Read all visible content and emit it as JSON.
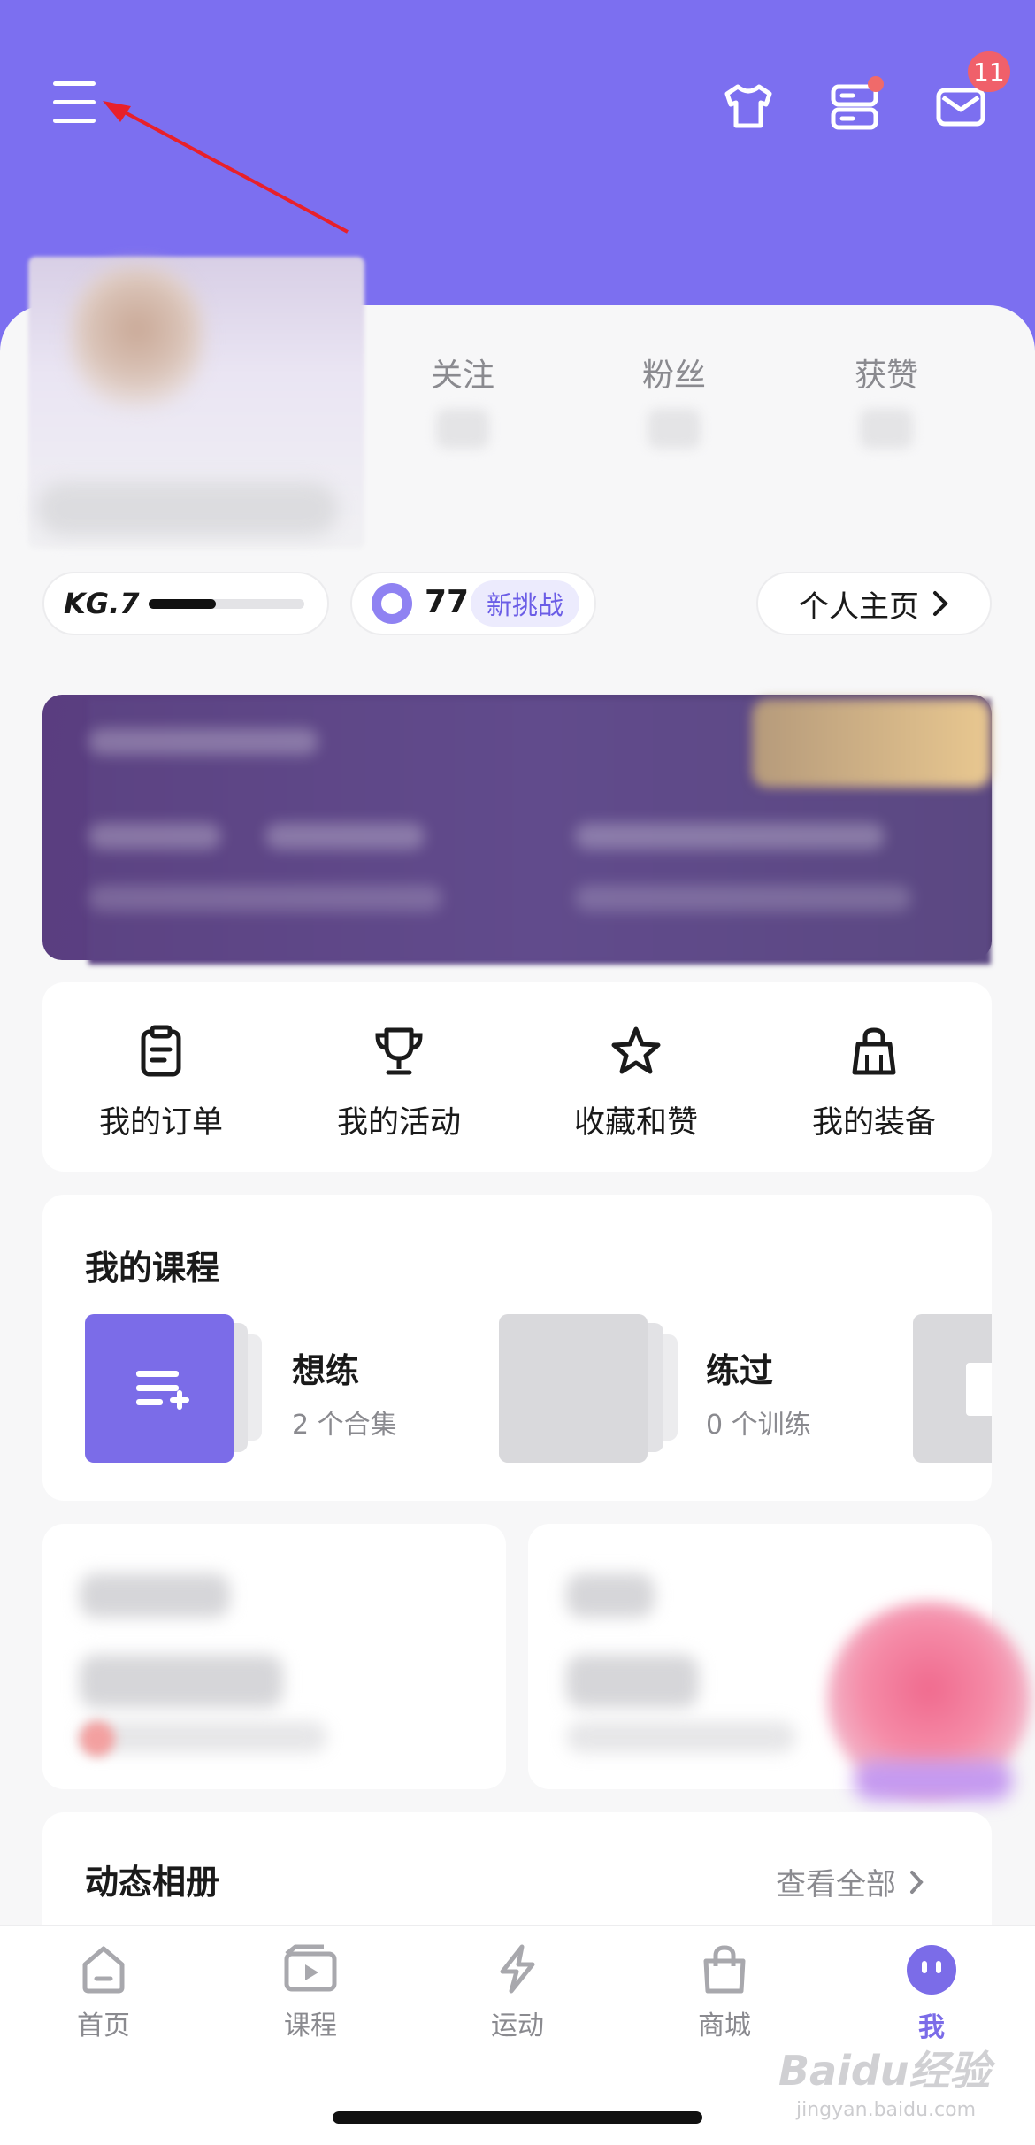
{
  "colors": {
    "header": "#7c6ff0",
    "accent": "#7b6ce8",
    "badge": "#f0606a"
  },
  "header": {
    "menu_icon": "hamburger-icon",
    "icons": [
      "shirt-icon",
      "server-icon",
      "mail-icon"
    ],
    "mail_badge": "11"
  },
  "profile": {
    "stats": [
      {
        "label": "关注"
      },
      {
        "label": "粉丝"
      },
      {
        "label": "获赞"
      }
    ]
  },
  "level": {
    "label": "KG.7",
    "progress": 0.43
  },
  "points": {
    "value": "77",
    "challenge_label": "新挑战"
  },
  "homepage_label": "个人主页",
  "shortcuts": [
    {
      "label": "我的订单",
      "icon": "clipboard-icon"
    },
    {
      "label": "我的活动",
      "icon": "trophy-icon"
    },
    {
      "label": "收藏和赞",
      "icon": "star-icon"
    },
    {
      "label": "我的装备",
      "icon": "bag-icon"
    }
  ],
  "courses": {
    "title": "我的课程",
    "items": [
      {
        "name": "想练",
        "sub": "2 个合集"
      },
      {
        "name": "练过",
        "sub": "0 个训练"
      }
    ]
  },
  "album": {
    "title": "动态相册",
    "view_all": "查看全部"
  },
  "tabs": [
    {
      "label": "首页",
      "icon": "home-icon"
    },
    {
      "label": "课程",
      "icon": "video-icon"
    },
    {
      "label": "运动",
      "icon": "lightning-icon"
    },
    {
      "label": "商城",
      "icon": "shopping-bag-icon"
    },
    {
      "label": "我",
      "icon": "profile-face-icon"
    }
  ],
  "watermark": {
    "text": "Baidu经验",
    "sub": "jingyan.baidu.com"
  }
}
